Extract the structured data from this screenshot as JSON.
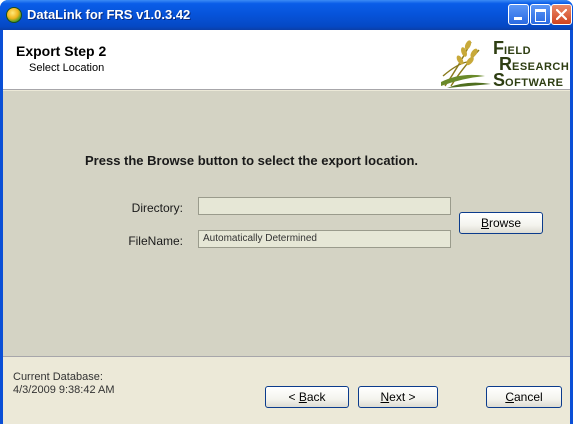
{
  "window": {
    "title": "DataLink for FRS v1.0.3.42"
  },
  "header": {
    "step_title": "Export Step 2",
    "step_subtitle": "Select Location",
    "logo": {
      "line1_cap": "F",
      "line1_rest": "IELD",
      "line2_cap": "R",
      "line2_rest": "ESEARCH",
      "line3_cap": "S",
      "line3_rest": "OFTWARE"
    }
  },
  "main": {
    "instruction": "Press the Browse button to select the export location.",
    "directory": {
      "label": "Directory:",
      "value": ""
    },
    "filename": {
      "label": "FileName:",
      "value": "Automatically Determined"
    },
    "browse": {
      "mnemonic": "B",
      "rest": "rowse"
    }
  },
  "footer": {
    "db_label": "Current Database:",
    "db_value": "4/3/2009 9:38:42 AM",
    "back": {
      "prefix": "< ",
      "mnemonic": "B",
      "rest": "ack"
    },
    "next": {
      "mnemonic": "N",
      "rest": "ext >"
    },
    "cancel": {
      "mnemonic": "C",
      "rest": "ancel"
    }
  },
  "colors": {
    "titlebar": "#0653d9",
    "window_bg": "#ece9d8",
    "content_bg": "#d4d3c4",
    "button_border": "#0b3b8c",
    "close_button": "#d0431e"
  },
  "icons": [
    "app-icon",
    "minimize-icon",
    "maximize-icon",
    "close-icon",
    "field-research-software-logo"
  ]
}
